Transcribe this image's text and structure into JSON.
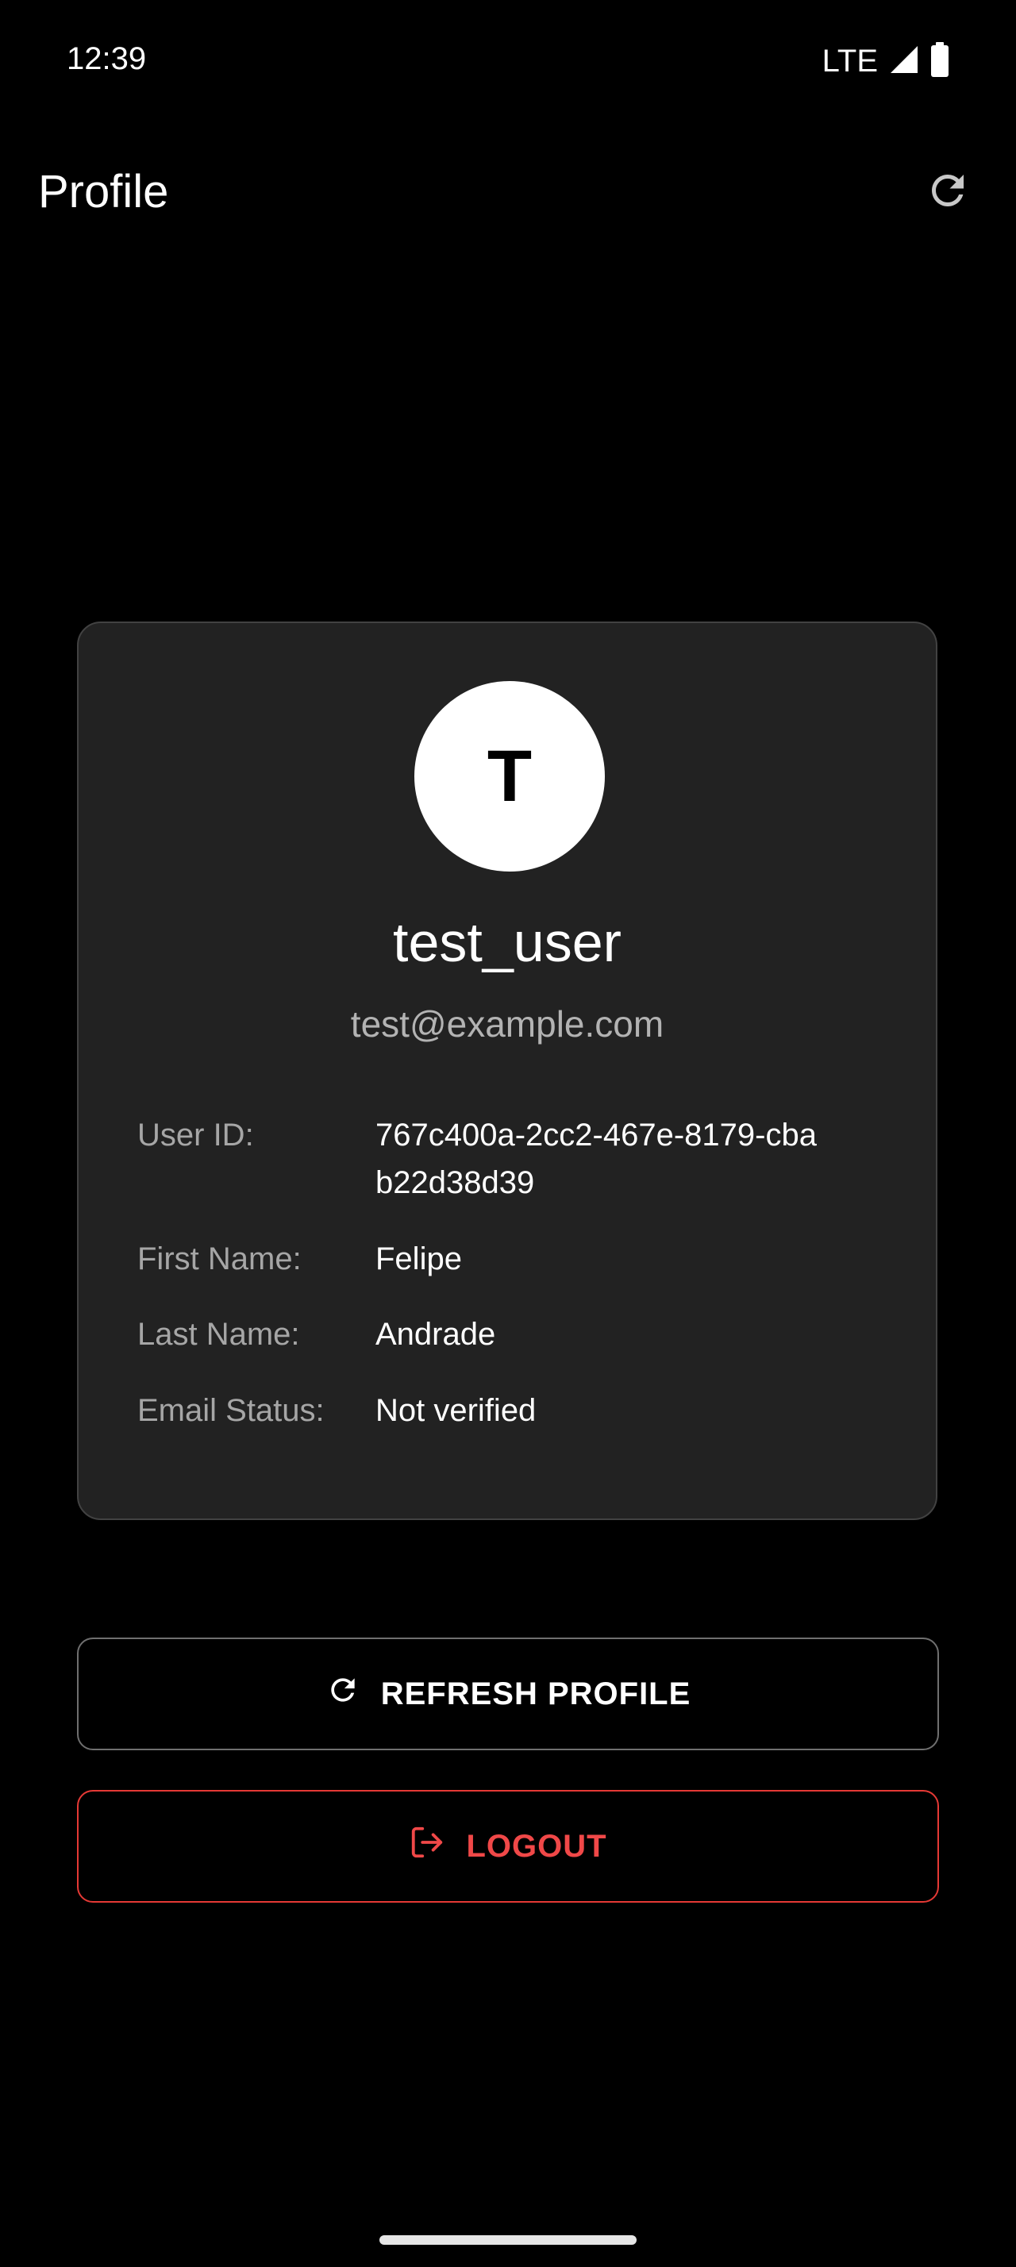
{
  "status_bar": {
    "time": "12:39",
    "network": "LTE",
    "icons": [
      "signal-icon",
      "battery-icon"
    ]
  },
  "app_bar": {
    "title": "Profile",
    "action_icon": "refresh-icon"
  },
  "profile": {
    "avatar_initial": "T",
    "username": "test_user",
    "email": "test@example.com",
    "details": [
      {
        "label": "User ID:",
        "value": "767c400a-2cc2-467e-8179-cbab22d38d39"
      },
      {
        "label": "First Name:",
        "value": "Felipe"
      },
      {
        "label": "Last Name:",
        "value": "Andrade"
      },
      {
        "label": "Email Status:",
        "value": "Not verified"
      }
    ]
  },
  "actions": {
    "refresh_label": "REFRESH PROFILE",
    "refresh_icon": "refresh-icon",
    "logout_label": "LOGOUT",
    "logout_icon": "logout-icon"
  },
  "colors": {
    "background": "#000000",
    "card": "#222222",
    "danger": "#e53935"
  }
}
